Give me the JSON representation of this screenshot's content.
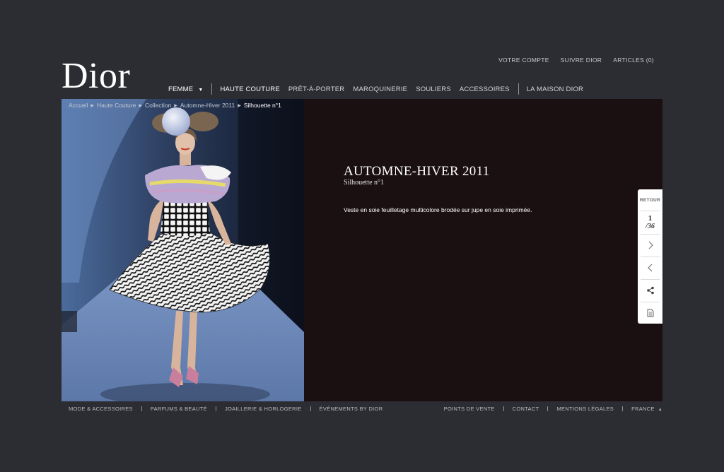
{
  "brand": {
    "logo_text": "Dior"
  },
  "account_nav": [
    "VOTRE COMPTE",
    "SUIVRE DIOR",
    "ARTICLES (0)"
  ],
  "main_nav": {
    "femme": "FEMME",
    "haute_couture": "HAUTE COUTURE",
    "pret_a_porter": "PRÊT-À-PORTER",
    "maroquinerie": "MAROQUINERIE",
    "souliers": "SOULIERS",
    "accessoires": "ACCESSOIRES",
    "maison": "LA MAISON DIOR"
  },
  "breadcrumb": [
    "Accueil",
    "Haute Couture",
    "Collection",
    "Automne-Hiver 2011",
    "Silhouette n°1"
  ],
  "look": {
    "title": "AUTOMNE-HIVER 2011",
    "subtitle": "Silhouette n°1",
    "description": "Veste en soie feuilletage multicolore brodée sur jupe en soie imprimée."
  },
  "sidepanel": {
    "back": "RETOUR",
    "current": "1",
    "total": "/36",
    "icons": [
      "next-arrow-icon",
      "prev-arrow-icon",
      "share-icon",
      "document-icon"
    ]
  },
  "footer": {
    "left": [
      "MODE & ACCESSOIRES",
      "PARFUMS & BEAUTÉ",
      "JOAILLERIE & HORLOGERIE",
      "ÉVÉNEMENTS BY DIOR"
    ],
    "right": [
      "POINTS DE VENTE",
      "CONTACT",
      "MENTIONS LÉGALES",
      "FRANCE"
    ]
  },
  "colors": {
    "page_bg": "#2b2d32",
    "stage_bg": "#1b1011",
    "runway_blue": "#6b84ad"
  }
}
